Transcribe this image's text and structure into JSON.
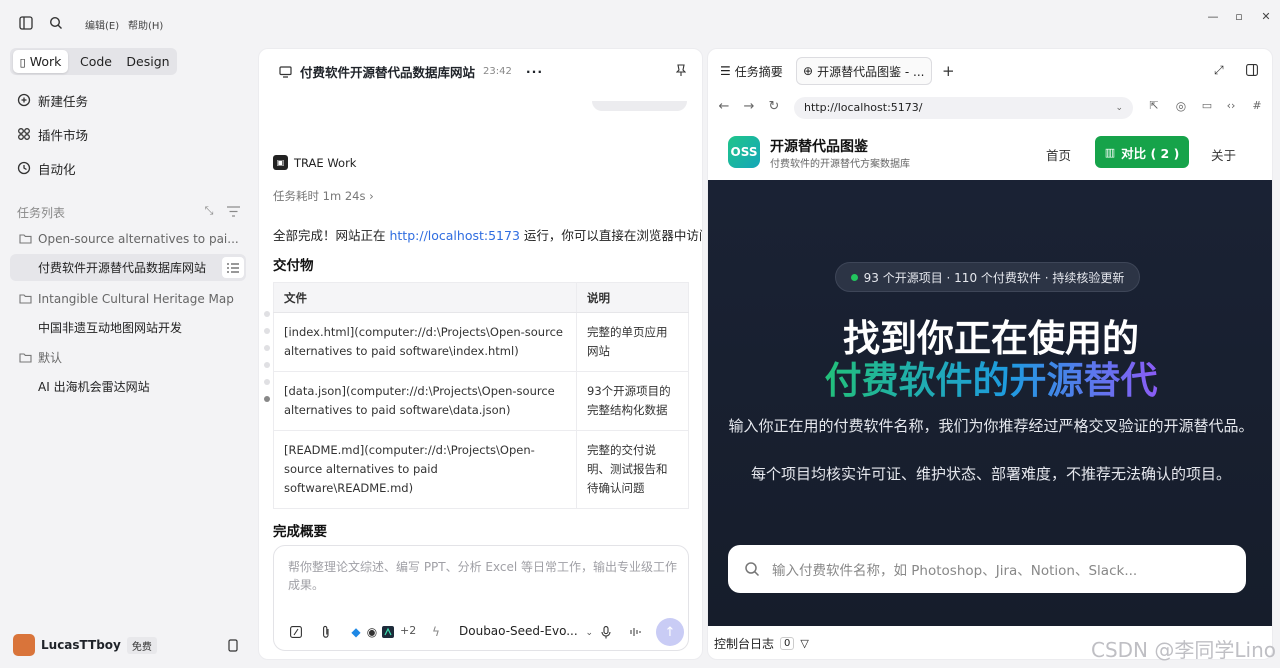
{
  "titlebar": {
    "menu": [
      "编辑(E)",
      "帮助(H)"
    ]
  },
  "sidebar": {
    "segments": [
      "Work",
      "Code",
      "Design"
    ],
    "nav": [
      "新建任务",
      "插件市场",
      "自动化"
    ],
    "section_title": "任务列表",
    "tree": [
      {
        "label": "Open-source alternatives to pai...",
        "type": "folder"
      },
      {
        "label": "付费软件开源替代品数据库网站",
        "type": "child",
        "selected": true
      },
      {
        "label": "Intangible Cultural Heritage Map",
        "type": "folder"
      },
      {
        "label": "中国非遗互动地图网站开发",
        "type": "child"
      },
      {
        "label": "默认",
        "type": "folder"
      },
      {
        "label": "AI 出海机会雷达网站",
        "type": "child"
      }
    ],
    "user": {
      "name": "LucasTTboy",
      "plan": "免费"
    }
  },
  "chat": {
    "title": "付费软件开源替代品数据库网站",
    "time": "23:42",
    "agent": "TRAE Work",
    "duration": "任务耗时 1m 24s ›",
    "done_pre": "全部完成！网站正在 ",
    "done_link": "http://localhost:5173",
    "done_post": " 运行，你可以直接在浏览器中访问。",
    "deliverables_title": "交付物",
    "table": {
      "headers": [
        "文件",
        "说明"
      ],
      "rows": [
        [
          "[index.html](computer://d:\\Projects\\Open-source alternatives to paid software\\index.html)",
          "完整的单页应用网站"
        ],
        [
          "[data.json](computer://d:\\Projects\\Open-source alternatives to paid software\\data.json)",
          "93个开源项目的完整结构化数据"
        ],
        [
          "[README.md](computer://d:\\Projects\\Open-source alternatives to paid software\\README.md)",
          "完整的交付说明、测试报告和待确认问题"
        ]
      ]
    },
    "summary_title": "完成概要",
    "input_placeholder": "帮你整理论文综述、编写 PPT、分析 Excel 等日常工作，输出专业级工作成果。",
    "plus_count": "+2",
    "model": "Doubao-Seed-Evo..."
  },
  "browser": {
    "tabs": [
      "任务摘要",
      "开源替代品图鉴 - ..."
    ],
    "url": "http://localhost:5173/",
    "site": {
      "logo": "OSS",
      "name": "开源替代品图鉴",
      "tagline": "付费软件的开源替代方案数据库",
      "nav_home": "首页",
      "compare": "对比 ( 2 )",
      "about": "关于",
      "pill": "93  个开源项目 · 110  个付费软件 · 持续核验更新",
      "headline1": "找到你正在使用的",
      "headline2": "付费软件的开源替代",
      "desc1": "输入你正在用的付费软件名称，我们为你推荐经过严格交叉验证的开源替代品。",
      "desc2": "每个项目均核实许可证、维护状态、部署难度，不推荐无法确认的项目。",
      "search_placeholder": "输入付费软件名称，如 Photoshop、Jira、Notion、Slack..."
    },
    "console": "控制台日志",
    "console_count": "0"
  },
  "watermark": "CSDN @李同学Lino",
  "colors": {
    "accent_green": "#16a34a",
    "hero_bg": "#1a2234",
    "link": "#2f6de0"
  }
}
